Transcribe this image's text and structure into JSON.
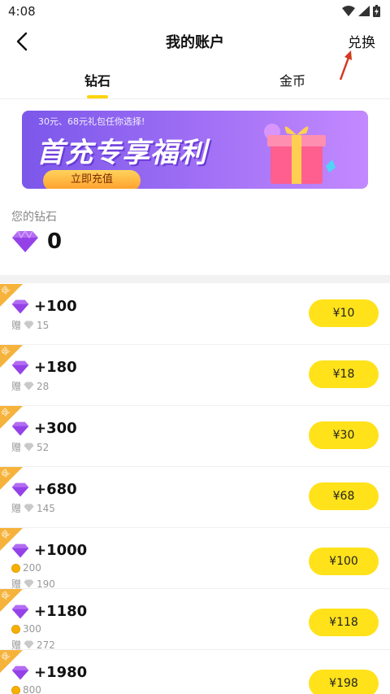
{
  "status_bar": {
    "time": "4:08"
  },
  "header": {
    "title": "我的账户",
    "exchange_label": "兑换"
  },
  "tabs": [
    {
      "label": "钻石",
      "active": true
    },
    {
      "label": "金币",
      "active": false
    }
  ],
  "banner": {
    "subtitle": "30元、68元礼包任你选择!",
    "headline": "首充专享福利",
    "cta": "立即充值"
  },
  "balance": {
    "label": "您的钻石",
    "value": "0"
  },
  "packs": [
    {
      "badge": "促",
      "amount": "+100",
      "gift_label": "赠",
      "gift_gems": "15",
      "price": "¥10"
    },
    {
      "badge": "促",
      "amount": "+180",
      "gift_label": "赠",
      "gift_gems": "28",
      "price": "¥18"
    },
    {
      "badge": "促",
      "amount": "+300",
      "gift_label": "赠",
      "gift_gems": "52",
      "price": "¥30"
    },
    {
      "badge": "促",
      "amount": "+680",
      "gift_label": "赠",
      "gift_gems": "145",
      "price": "¥68"
    },
    {
      "badge": "促",
      "amount": "+1000",
      "coins": "200",
      "gift_label": "赠",
      "gift_gems": "190",
      "price": "¥100"
    },
    {
      "badge": "促",
      "amount": "+1180",
      "coins": "300",
      "gift_label": "赠",
      "gift_gems": "272",
      "price": "¥118"
    },
    {
      "badge": "促",
      "amount": "+1980",
      "coins": "800",
      "price": "¥198"
    }
  ],
  "colors": {
    "accent": "#ffe21a",
    "badge": "#f6b33c",
    "gem": "#9b4df0"
  }
}
